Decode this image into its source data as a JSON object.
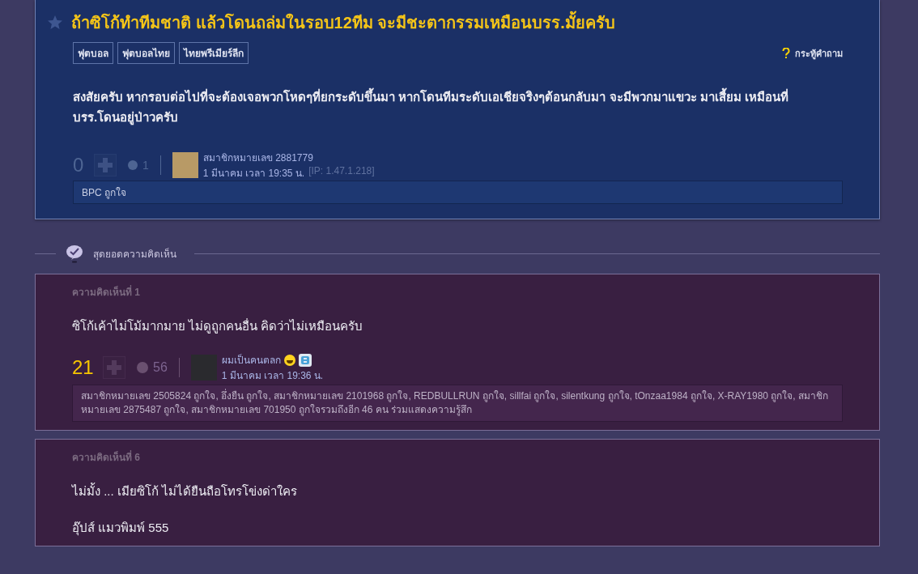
{
  "topic": {
    "starred": false,
    "title": "ถ้าซิโก้ทำทีมชาติ แล้วโดนถล่มในรอบ12ทีม จะมีชะตากรรมเหมือนบรร.มั้ยครับ",
    "tags": [
      "ฟุตบอล",
      "ฟุตบอลไทย",
      "ไทยพรีเมียร์ลีก"
    ],
    "type_label": "กระทู้คำถาม",
    "body": "สงสัยครับ  หากรอบต่อไปที่จะต้องเจอพวกโหดๆที่ยกระดับขึ้นมา   หากโดนทีมระดับเอเชียจริงๆต้อนกลับมา   จะมีพวกมาแขวะ มาเสี้ยม  เหมือนที่บรร.โดนอยู่ป่าวครับ",
    "score": "0",
    "reaction_count": "1",
    "author": "สมาชิกหมายเลข 2881779",
    "time": "1 มีนาคม เวลา 19:35 น.",
    "ip": "[IP: 1.47.1.218]",
    "likes": "BPC ถูกใจ"
  },
  "section_title": "สุดยอดความคิดเห็น",
  "comments": [
    {
      "label": "ความคิดเห็นที่ 1",
      "paragraphs": [
        "ซิโก้เค้าไม่โม้มากมาย ไม่ดูถูกคนอื่น คิดว่าไม่เหมือนครับ"
      ],
      "score": "21",
      "reaction_count": "56",
      "author": "ผมเป็นคนตลก",
      "badges": true,
      "time": "1 มีนาคม เวลา 19:36 น.",
      "likes": "สมาชิกหมายเลข 2505824 ถูกใจ, อึ่งยืน ถูกใจ, สมาชิกหมายเลข 2101968 ถูกใจ, REDBULLRUN ถูกใจ, sillfai ถูกใจ, silentkung ถูกใจ, tOnzaa1984 ถูกใจ, X-RAY1980 ถูกใจ, สมาชิกหมายเลข 2875487 ถูกใจ, สมาชิกหมายเลข 701950 ถูกใจรวมถึงอีก 46 คน ร่วมแสดงความรู้สึก"
    },
    {
      "label": "ความคิดเห็นที่ 6",
      "paragraphs": [
        "ไม่มั้ง ... เมียซิโก้ ไม่ได้ยืนถือโทรโข่งด่าใคร",
        "อุ๊ปส์ แมวพิมพ์ 555"
      ]
    }
  ]
}
